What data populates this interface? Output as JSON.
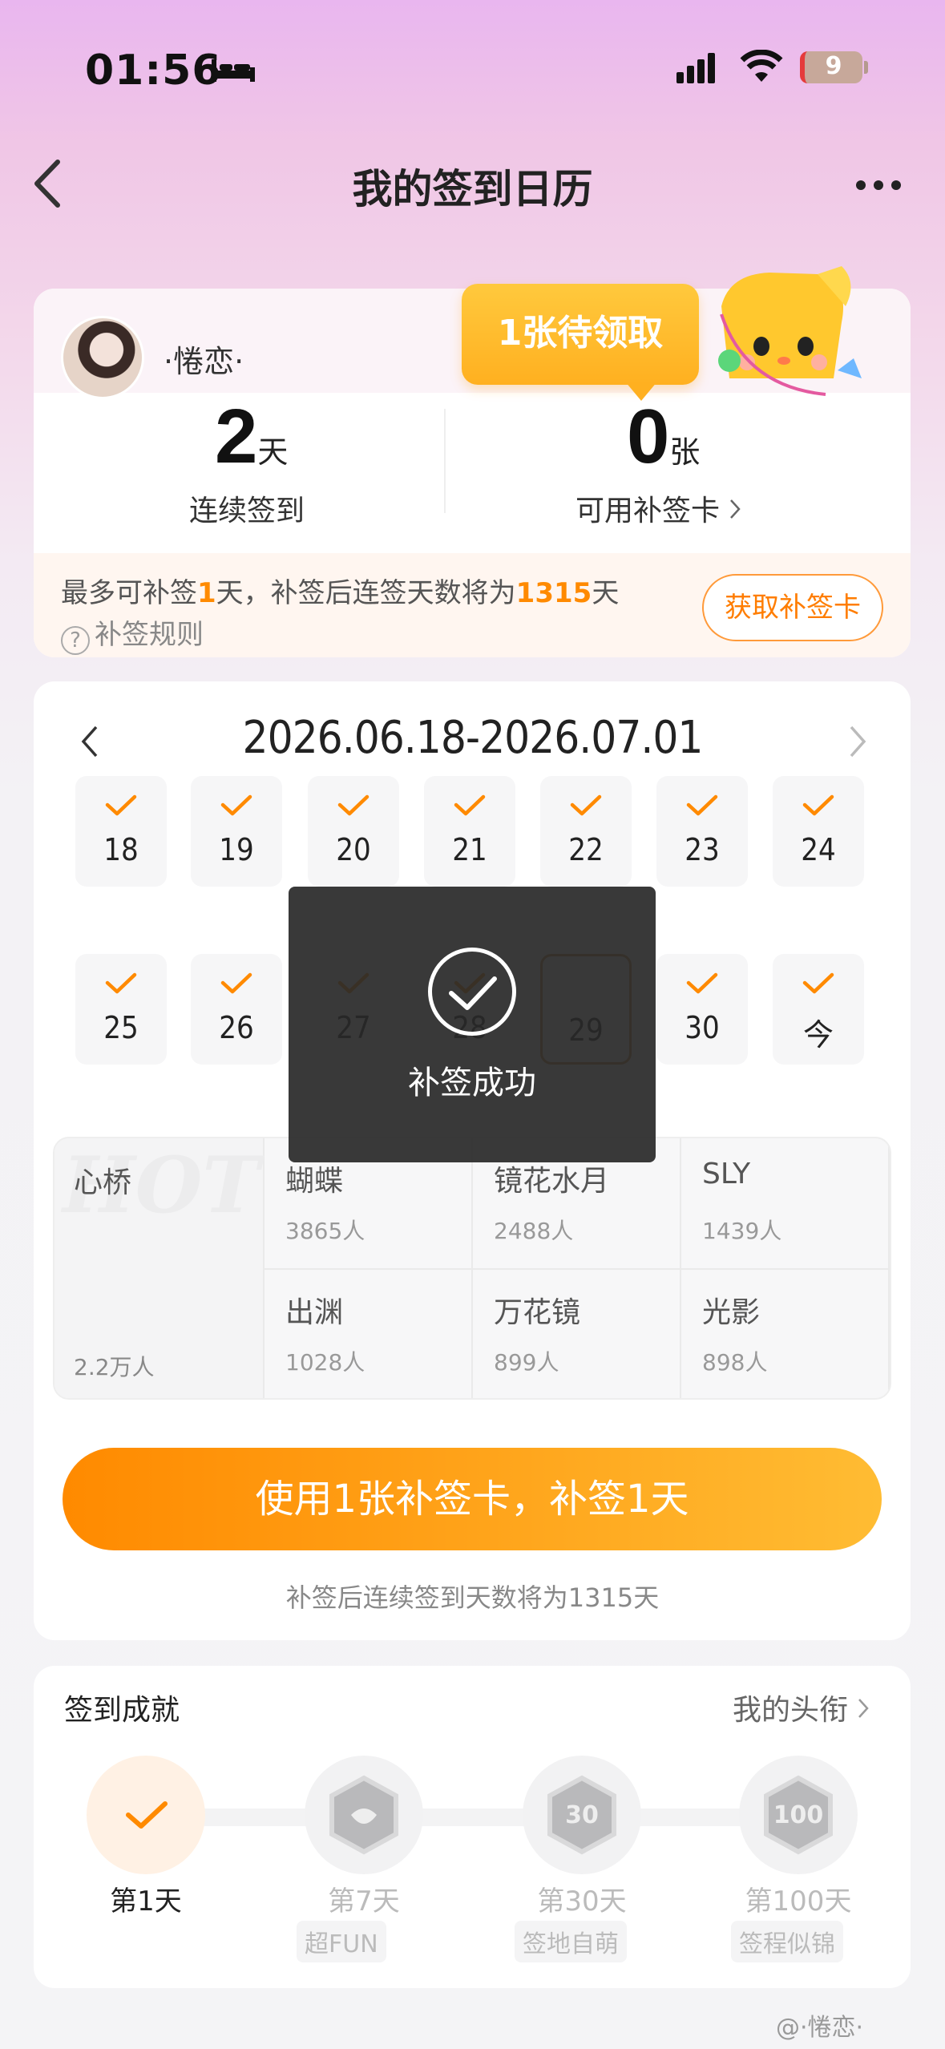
{
  "status_bar": {
    "time": "01:56",
    "battery": "9"
  },
  "nav": {
    "title": "我的签到日历"
  },
  "profile": {
    "username": "·惓恋·"
  },
  "stats": {
    "streak_value": "2",
    "streak_unit": "天",
    "streak_label": "连续签到",
    "cards_value": "0",
    "cards_unit": "张",
    "cards_label": "可用补签卡"
  },
  "bubble": {
    "text": "1张待领取"
  },
  "makeup": {
    "prefix": "最多可补签",
    "days": "1",
    "middle": "天，补签后连签天数将为",
    "total": "1315",
    "suffix": "天",
    "rules_icon": "?",
    "rules": "补签规则",
    "get_button": "获取补签卡"
  },
  "calendar": {
    "range": "2026.06.18-2026.07.01",
    "row1": [
      {
        "day": "18",
        "checked": true
      },
      {
        "day": "19",
        "checked": true
      },
      {
        "day": "20",
        "checked": true
      },
      {
        "day": "21",
        "checked": true
      },
      {
        "day": "22",
        "checked": true
      },
      {
        "day": "23",
        "checked": true
      },
      {
        "day": "24",
        "checked": true
      }
    ],
    "row2": [
      {
        "day": "25",
        "checked": true
      },
      {
        "day": "26",
        "checked": true
      },
      {
        "day": "27",
        "checked": true
      },
      {
        "day": "28",
        "checked": true
      },
      {
        "day": "29",
        "checked": false
      },
      {
        "day": "30",
        "checked": true
      },
      {
        "day": "今",
        "checked": true
      }
    ]
  },
  "toast": {
    "text": "补签成功"
  },
  "groups": {
    "hot": {
      "watermark": "HOT",
      "name": "心桥",
      "count": "2.2万人"
    },
    "cells": [
      {
        "name": "蝴蝶",
        "count": "3865人"
      },
      {
        "name": "镜花水月",
        "count": "2488人"
      },
      {
        "name": "SLY",
        "count": "1439人"
      },
      {
        "name": "出渊",
        "count": "1028人"
      },
      {
        "name": "万花镜",
        "count": "899人"
      },
      {
        "name": "光影",
        "count": "898人"
      }
    ]
  },
  "action": {
    "button": "使用1张补签卡，补签1天",
    "note": "补签后连续签到天数将为1315天"
  },
  "achievements": {
    "title": "签到成就",
    "link": "我的头衔",
    "items": [
      {
        "day": "第1天",
        "tag": "",
        "badge": ""
      },
      {
        "day": "第7天",
        "tag": "超FUN",
        "badge": ""
      },
      {
        "day": "第30天",
        "tag": "签地自萌",
        "badge": "30"
      },
      {
        "day": "第100天",
        "tag": "签程似锦",
        "badge": "100"
      }
    ]
  },
  "watermark": "@·惓恋·",
  "colors": {
    "accent": "#ff8a00",
    "accent_light": "#ffbc33",
    "bubble": "#ffb020"
  }
}
